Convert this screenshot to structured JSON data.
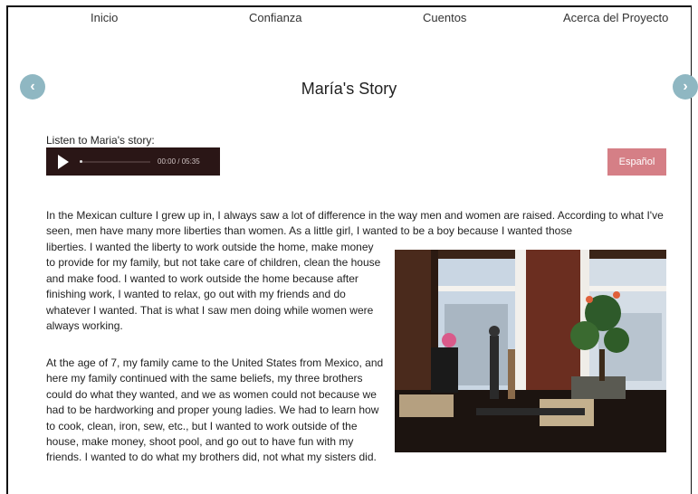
{
  "nav": {
    "items": [
      "Inicio",
      "Confianza",
      "Cuentos",
      "Acerca del Proyecto"
    ]
  },
  "page": {
    "title": "María's Story"
  },
  "audio": {
    "label": "Listen to Maria's story:",
    "time": "00:00 / 05:35",
    "progress": 0
  },
  "language_button": "Español",
  "story": {
    "para1_full": "In the Mexican culture I grew up in, I always saw a lot of difference in the way men and women are raised. According to what I've seen, men have many more liberties than women. As a little girl, I wanted to be a boy because I wanted those",
    "para1_rest": "liberties. I wanted the liberty to work outside the home, make money to provide for my family, but not take care of children, clean the house and make food. I wanted to work outside the home because after finishing work, I wanted to relax, go out with my friends and do whatever I wanted. That is what I saw men doing while women were always working.",
    "para2": "At the age of 7, my family came to the United States from Mexico, and here my family continued with the same beliefs, my three brothers could do what they wanted, and we as women could not because we had to be hardworking and proper young ladies. We had to learn how to cook, clean, iron, sew, etc., but I wanted to work outside of the house, make money, shoot pool, and go out to have fun with my friends. I wanted to do what my brothers did, not what my sisters did."
  },
  "icons": {
    "prev": "chevron-left-icon",
    "next": "chevron-right-icon",
    "play": "play-icon"
  },
  "colors": {
    "arrow": "#8fb7c2",
    "player_bg": "#2a1616",
    "language_button": "#d57f86"
  }
}
